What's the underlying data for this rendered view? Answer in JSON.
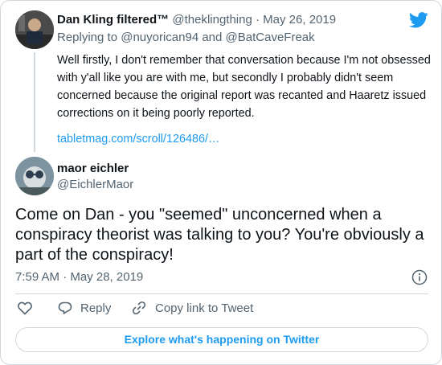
{
  "parent_tweet": {
    "display_name": "Dan Kling filtered™",
    "handle": "@theklingthing",
    "separator": "·",
    "date": "May 26, 2019",
    "replying_prefix": "Replying to",
    "reply_to_1": "@nuyorican94",
    "reply_joiner": "and",
    "reply_to_2": "@BatCaveFreak",
    "text": "Well firstly, I don't remember that conversation because I'm not obsessed with y'all like you are with me, but secondly I probably didn't seem concerned because the original report was recanted and Haaretz issued corrections on it being poorly reported.",
    "link": "tabletmag.com/scroll/126486/…"
  },
  "main_tweet": {
    "display_name": "maor eichler",
    "handle": "@EichlerMaor",
    "text": "Come on Dan - you \"seemed\" unconcerned when a conspiracy theorist was talking to you? You're obviously a part of the conspiracy!",
    "timestamp": "7:59 AM · May 28, 2019"
  },
  "actions": {
    "reply_label": "Reply",
    "copy_link_label": "Copy link to Tweet"
  },
  "explore_label": "Explore what's happening on Twitter",
  "icons": [
    "twitter-bird-icon",
    "info-icon",
    "heart-icon",
    "reply-bubble-icon",
    "link-icon"
  ],
  "colors": {
    "accent": "#1d9bf0",
    "secondary_text": "#536471",
    "border": "#cfd9de"
  }
}
